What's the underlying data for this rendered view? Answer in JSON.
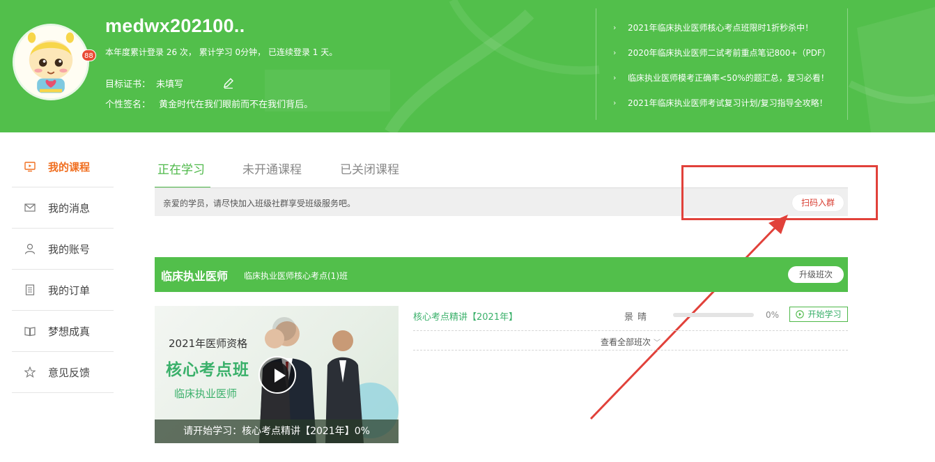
{
  "header": {
    "username": "medwx202100..",
    "stats": "本年度累计登录 26 次， 累计学习 0分钟， 已连续登录 1 天。",
    "target_label": "目标证书：",
    "target_value": "未填写",
    "signature_label": "个性签名：",
    "signature_value": "黄金时代在我们眼前而不在我们背后。",
    "news": [
      "2021年临床执业医师核心考点班限时1折秒杀中！",
      "2020年临床执业医师二试考前重点笔记800+（PDF）",
      "临床执业医师模考正确率<50%的题汇总，复习必看！",
      "2021年临床执业医师考试复习计划/复习指导全攻略！"
    ]
  },
  "sidebar": {
    "items": [
      {
        "label": "我的课程",
        "icon": "monitor-icon"
      },
      {
        "label": "我的消息",
        "icon": "mail-icon"
      },
      {
        "label": "我的账号",
        "icon": "user-icon"
      },
      {
        "label": "我的订单",
        "icon": "document-icon"
      },
      {
        "label": "梦想成真",
        "icon": "book-icon"
      },
      {
        "label": "意见反馈",
        "icon": "star-icon"
      }
    ],
    "message_badge": "88"
  },
  "tabs": [
    "正在学习",
    "未开通课程",
    "已关闭课程"
  ],
  "notice": {
    "text": "亲爱的学员，请尽快加入班级社群享受班级服务吧。",
    "button": "扫码入群"
  },
  "course": {
    "name": "临床执业医师",
    "class_name": "临床执业医师核心考点(1)班",
    "upgrade_button": "升级班次",
    "thumbnail": {
      "line1": "2021年医师资格",
      "line2": "核心考点班",
      "line3": "临床执业医师",
      "caption": "请开始学习：核心考点精讲【2021年】0%"
    },
    "lesson": {
      "title": "核心考点精讲【2021年】",
      "teacher": "景晴",
      "progress_percent": 0,
      "progress_text": "0%",
      "start_button": "开始学习"
    },
    "view_all": "查看全部班次"
  },
  "colors": {
    "brand_green": "#52bf4b",
    "active_orange": "#f06e1f",
    "annotation_red": "#e1413a",
    "badge_red": "#e94b35"
  }
}
